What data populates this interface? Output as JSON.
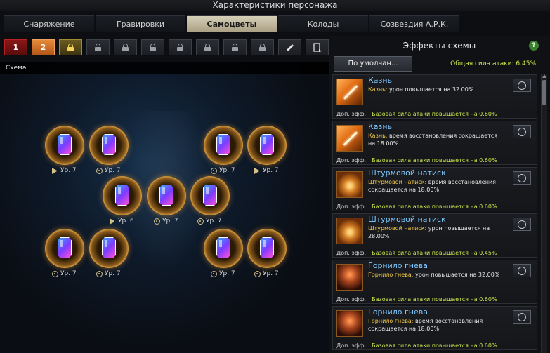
{
  "window": {
    "title": "Характеристики персонажа"
  },
  "tabs": [
    {
      "label": "Снаряжение"
    },
    {
      "label": "Гравировки"
    },
    {
      "label": "Самоцветы",
      "active": true
    },
    {
      "label": "Колоды"
    },
    {
      "label": "Созвездия А.Р.К."
    }
  ],
  "toolbar": {
    "preset_1": "1",
    "preset_2": "2",
    "lock_icon": "lock-icon",
    "edit_icon": "pencil-icon",
    "apply_icon": "apply-icon"
  },
  "schema": {
    "label": "Схема"
  },
  "gems": [
    {
      "level": "Ур. 7",
      "marker": "play"
    },
    {
      "level": "Ур. 7",
      "marker": "target"
    },
    {
      "level": "Ур. 7",
      "marker": "target"
    },
    {
      "level": "Ур. 7",
      "marker": "play"
    },
    {
      "level": "Ур. 6",
      "marker": "play"
    },
    {
      "level": "Ур. 7",
      "marker": "target"
    },
    {
      "level": "Ур. 7",
      "marker": "target"
    },
    {
      "level": "Ур. 7",
      "marker": "target"
    },
    {
      "level": "Ур. 7",
      "marker": "target"
    },
    {
      "level": "Ур. 7",
      "marker": "target"
    },
    {
      "level": "Ур. 7",
      "marker": "target"
    }
  ],
  "panel": {
    "title": "Эффекты схемы",
    "help": "?",
    "preset_button": "По умолчан...",
    "total": "Общая сила атаки: 6.45%"
  },
  "effects": [
    {
      "name": "Казнь",
      "kw": "Казнь:",
      "desc": "урон повышается на 32.00%",
      "bonus_label": "Доп. эфф.",
      "bonus": "Базовая сила атаки повышается на 0.60%",
      "icon": "slash"
    },
    {
      "name": "Казнь",
      "kw": "Казнь:",
      "desc": "время восстановления сокращается на 18.00%",
      "bonus_label": "Доп. эфф.",
      "bonus": "Базовая сила атаки повышается на 0.60%",
      "icon": "slash"
    },
    {
      "name": "Штурмовой натиск",
      "kw": "Штурмовой натиск:",
      "desc": "время восстановления сокращается на 18.00%",
      "bonus_label": "Доп. эфф.",
      "bonus": "Базовая сила атаки повышается на 0.60%",
      "icon": "storm"
    },
    {
      "name": "Штурмовой натиск",
      "kw": "Штурмовой натиск:",
      "desc": "урон повышается на 28.00%",
      "bonus_label": "Доп. эфф.",
      "bonus": "Базовая сила атаки повышается на 0.45%",
      "icon": "storm"
    },
    {
      "name": "Горнило гнева",
      "kw": "Горнило гнева:",
      "desc": "урон повышается на 32.00%",
      "bonus_label": "Доп. эфф.",
      "bonus": "Базовая сила атаки повышается на 0.60%",
      "icon": "rage"
    },
    {
      "name": "Горнило гнева",
      "kw": "Горнило гнева:",
      "desc": "время восстановления сокращается на 18.00%",
      "bonus_label": "Доп. эфф.",
      "bonus": "Базовая сила атаки повышается на 0.60%",
      "icon": "rage"
    }
  ]
}
